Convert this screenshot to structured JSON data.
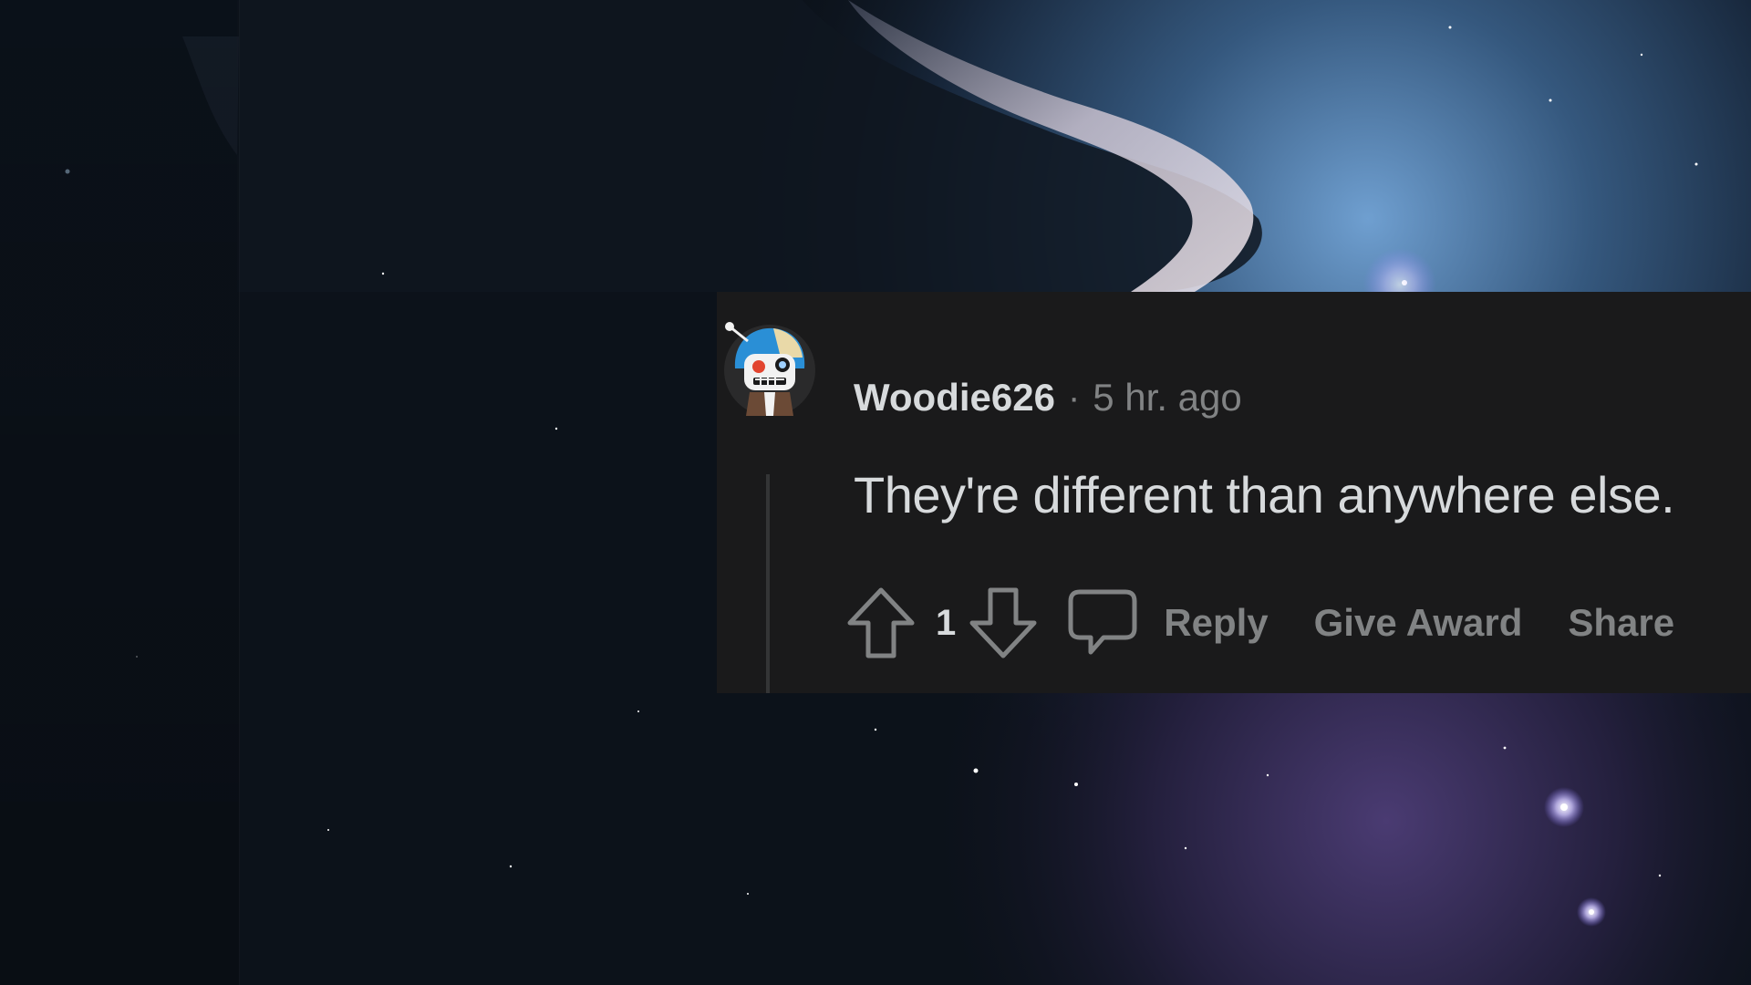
{
  "comment": {
    "username": "Woodie626",
    "separator": "·",
    "timestamp": "5 hr. ago",
    "body": "They're different than anywhere else.",
    "score": "1"
  },
  "actions": {
    "reply_label": "Reply",
    "award_label": "Give Award",
    "share_label": "Share"
  },
  "icons": {
    "avatar": "snoo-avatar",
    "upvote": "upvote-arrow-icon",
    "downvote": "downvote-arrow-icon",
    "comment": "speech-bubble-icon"
  },
  "colors": {
    "card_background": "#1a1a1b",
    "primary_text": "#d7dadc",
    "secondary_text": "#818384",
    "thread_line": "#343536"
  }
}
